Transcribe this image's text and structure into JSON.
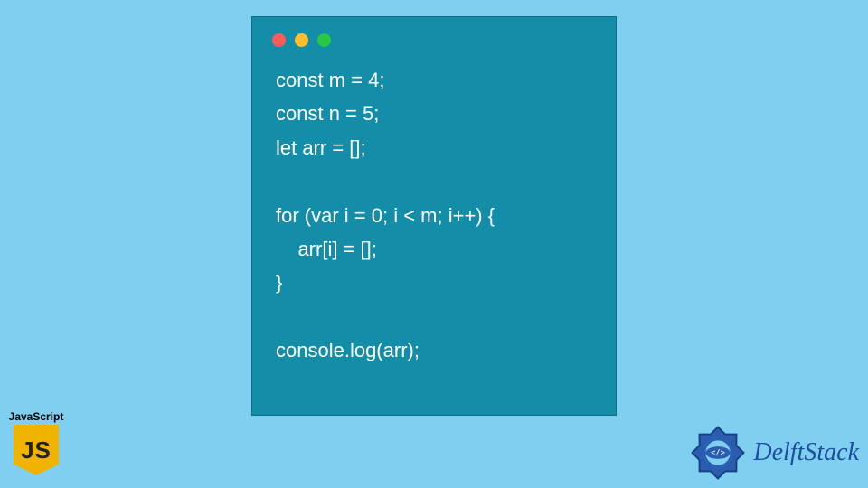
{
  "window": {
    "dots": [
      "red",
      "yellow",
      "green"
    ]
  },
  "code": {
    "lines": [
      "const m = 4;",
      "const n = 5;",
      "let arr = [];",
      "",
      "for (var i = 0; i < m; i++) {",
      "    arr[i] = [];",
      "}",
      "",
      "console.log(arr);"
    ]
  },
  "js_badge": {
    "label": "JavaScript",
    "shield_text": "JS"
  },
  "brand": {
    "name": "DelftStack",
    "tag_text": "</>"
  }
}
